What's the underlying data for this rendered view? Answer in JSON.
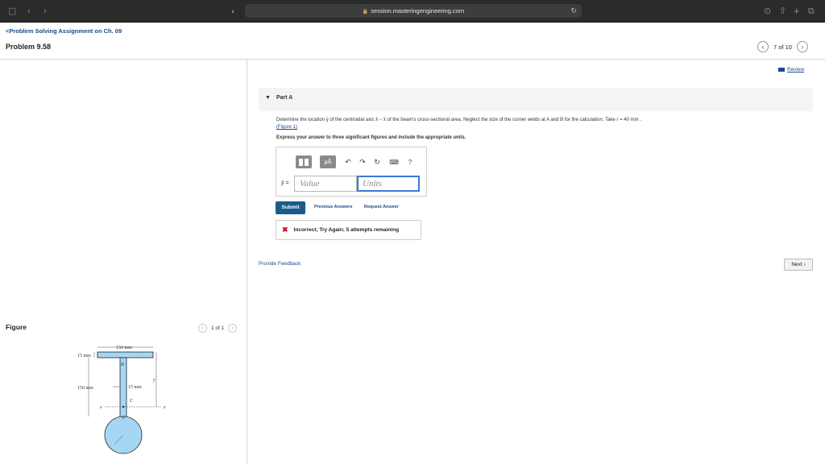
{
  "browser": {
    "url": "session.masteringengineering.com"
  },
  "header": {
    "breadcrumb": "<Problem Solving Assignment on Ch. 09",
    "problem_title": "Problem 9.58",
    "pager_text": "7 of 10"
  },
  "review": {
    "label": "Review"
  },
  "part": {
    "label": "Part A",
    "question": "Determine the location ȳ of the centroidal axis x̄ − x̄ of the beam's cross-sectional area. Neglect the size of the corner welds at A and B for the calculation. Take r = 40 mm .",
    "figure_link": "(Figure 1)",
    "instruction": "Express your answer to three significant figures and include the appropriate units."
  },
  "answer": {
    "var_label": "ȳ =",
    "value_placeholder": "Value",
    "units_placeholder": "Units",
    "toolbar": {
      "mu": "μÅ",
      "help": "?"
    }
  },
  "actions": {
    "submit": "Submit",
    "previous_answers": "Previous Answers",
    "request_answer": "Request Answer"
  },
  "feedback": {
    "icon": "✖",
    "text": "Incorrect; Try Again; 5 attempts remaining"
  },
  "provide_feedback": "Provide Feedback",
  "next_button": "Next",
  "figure": {
    "label": "Figure",
    "pager": "1 of 1",
    "labels": {
      "width": "150 mm",
      "flange": "15 mm",
      "height": "150 mm",
      "web": "15 mm",
      "b": "B",
      "c": "C",
      "a": "A",
      "y": "y",
      "x": "x"
    }
  },
  "colors": {
    "link": "#1a4b8c",
    "submit": "#1a5c8c",
    "error": "#c8102e",
    "beam": "#a5d7f5"
  }
}
